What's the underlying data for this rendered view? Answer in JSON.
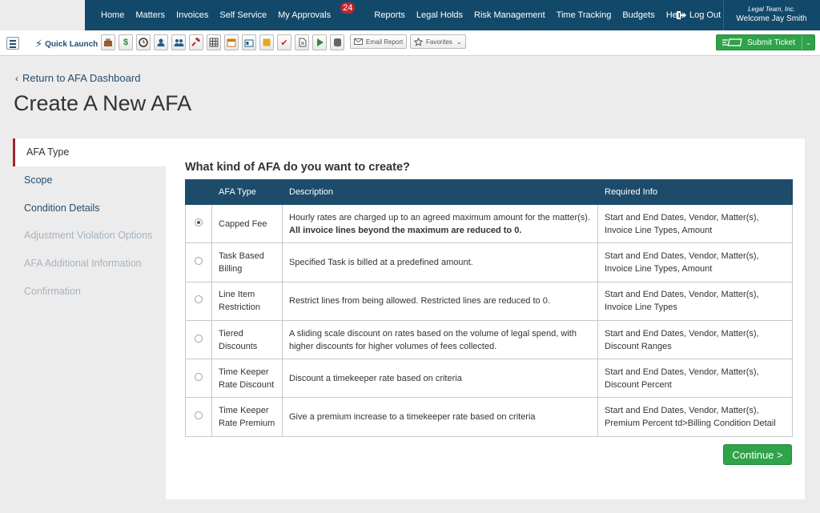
{
  "nav": {
    "links": [
      "Home",
      "Matters",
      "Invoices",
      "Self Service",
      "My Approvals",
      "Reports",
      "Legal Holds",
      "Risk Management",
      "Time Tracking",
      "Budgets",
      "Help"
    ],
    "approvals_badge": "24",
    "logout_label": "Log Out",
    "org": "Legal Team, Inc.",
    "welcome": "Welcome Jay Smith",
    "bar_color": "#12496a"
  },
  "toolbar": {
    "quick_launch_label": "Quick Launch",
    "icons": [
      "briefcase-icon",
      "dollar-icon",
      "clock-icon",
      "person-icon",
      "people-icon",
      "gavel-icon",
      "grid-icon",
      "calendar-icon",
      "card-icon",
      "note-icon",
      "checkmark-icon",
      "document-icon",
      "play-icon",
      "database-icon"
    ],
    "email_report_label": "Email Report",
    "favorites_label": "Favorites",
    "submit_ticket_label": "Submit Ticket"
  },
  "page": {
    "back_label": "Return to AFA Dashboard",
    "title": "Create A New AFA"
  },
  "steps": [
    {
      "label": "AFA Type",
      "state": "active"
    },
    {
      "label": "Scope",
      "state": "enabled"
    },
    {
      "label": "Condition Details",
      "state": "enabled"
    },
    {
      "label": "Adjustment Violation Options",
      "state": "disabled"
    },
    {
      "label": "AFA Additional Information",
      "state": "disabled"
    },
    {
      "label": "Confirmation",
      "state": "disabled"
    }
  ],
  "form": {
    "question": "What kind of AFA do you want to create?",
    "columns": [
      "AFA Type",
      "Description",
      "Required Info"
    ],
    "rows": [
      {
        "selected": true,
        "type_line1": "Capped Fee",
        "type_line2": "",
        "desc": "Hourly rates are charged up to an agreed maximum amount for the matter(s).",
        "desc_bold": "All invoice lines beyond the maximum are reduced to 0.",
        "req_line1": "Start and End Dates, Vendor, Matter(s),",
        "req_line2": "Invoice Line Types, Amount"
      },
      {
        "selected": false,
        "type_line1": "Task Based",
        "type_line2": "Billing",
        "desc": "Specified Task is billed at a predefined amount.",
        "desc_bold": "",
        "req_line1": "Start and End Dates, Vendor, Matter(s),",
        "req_line2": "Invoice Line Types, Amount"
      },
      {
        "selected": false,
        "type_line1": "Line Item",
        "type_line2": "Restriction",
        "desc": "Restrict lines from being allowed. Restricted lines are reduced to 0.",
        "desc_bold": "",
        "req_line1": "Start and End Dates, Vendor, Matter(s),",
        "req_line2": "Invoice Line Types"
      },
      {
        "selected": false,
        "type_line1": "Tiered",
        "type_line2": "Discounts",
        "desc": "A sliding scale discount on rates based on the volume of legal spend, with higher discounts for higher volumes of fees collected.",
        "desc_bold": "",
        "req_line1": "Start and End Dates, Vendor, Matter(s),",
        "req_line2": "Discount Ranges"
      },
      {
        "selected": false,
        "type_line1": "Time Keeper",
        "type_line2": "Rate Discount",
        "desc": "Discount a timekeeper rate based on criteria",
        "desc_bold": "",
        "req_line1": "Start and End Dates, Vendor, Matter(s),",
        "req_line2": "Discount Percent"
      },
      {
        "selected": false,
        "type_line1": "Time Keeper",
        "type_line2": "Rate Premium",
        "desc": "Give a premium increase to a timekeeper rate based on criteria",
        "desc_bold": "",
        "req_line1": "Start and End Dates, Vendor, Matter(s),",
        "req_line2": "Premium Percent td>Billing Condition Detail"
      }
    ],
    "continue_label": "Continue >",
    "header_color": "#1d4b6a",
    "accent_green": "#2fa34a"
  }
}
